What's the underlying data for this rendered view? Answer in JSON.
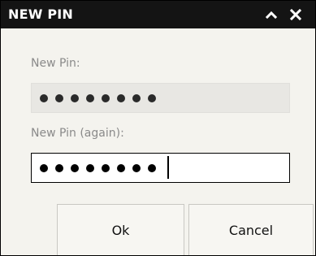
{
  "window": {
    "title": "NEW PIN",
    "controls": [
      {
        "name": "collapse",
        "icon": "chevron-up-icon"
      },
      {
        "name": "close",
        "icon": "close-icon"
      }
    ]
  },
  "form": {
    "fields": [
      {
        "label": "New Pin:",
        "masked_value": "••••••••",
        "state": "filled"
      },
      {
        "label": "New Pin (again):",
        "masked_value": "••••••••",
        "state": "focused"
      }
    ]
  },
  "buttons": {
    "ok_label": "Ok",
    "cancel_label": "Cancel"
  },
  "colors": {
    "titlebar": "#141414",
    "title_text": "#ffffff",
    "dialog_background": "#f4f3ee",
    "label_text": "#8a8a8a",
    "readonly_field": "#e8e7e3",
    "active_field": "#ffffff"
  }
}
